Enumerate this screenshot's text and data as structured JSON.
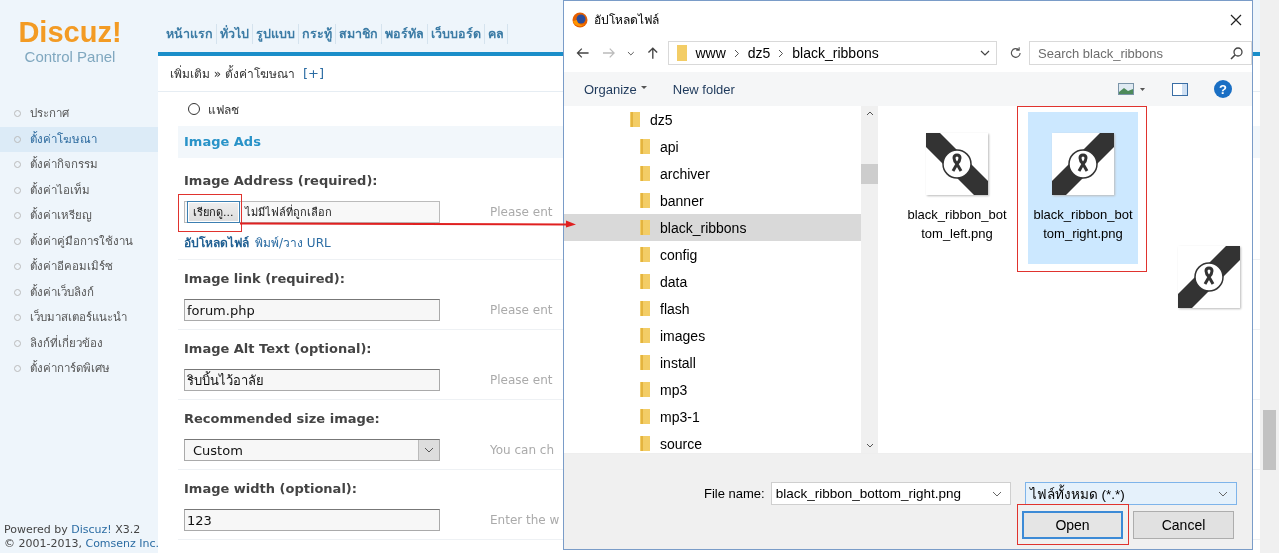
{
  "logo": {
    "name": "Discuz!",
    "subtitle": "Control Panel"
  },
  "nav": [
    "หน้าแรก",
    "ทั่วไป",
    "รูปแบบ",
    "กระทู้",
    "สมาชิก",
    "พอร์ทัล",
    "เว็บบอร์ด",
    "คล"
  ],
  "breadcrumb": {
    "path": "เพิ่มเติม » ตั้งค่าโฆษณา",
    "add": "[+]"
  },
  "sidebar": {
    "items": [
      {
        "label": "ประกาศ",
        "selected": false
      },
      {
        "label": "ตั้งค่าโฆษณา",
        "selected": true
      },
      {
        "label": "ตั้งค่ากิจกรรม",
        "selected": false
      },
      {
        "label": "ตั้งค่าไอเท็ม",
        "selected": false
      },
      {
        "label": "ตั้งค่าเหรียญ",
        "selected": false
      },
      {
        "label": "ตั้งค่าคู่มือการใช้งาน",
        "selected": false
      },
      {
        "label": "ตั้งค่าอีคอมเมิร์ซ",
        "selected": false
      },
      {
        "label": "ตั้งค่าเว็บลิงก์",
        "selected": false
      },
      {
        "label": "เว็บมาสเตอร์แนะนำ",
        "selected": false
      },
      {
        "label": "ลิงก์ที่เกี่ยวข้อง",
        "selected": false
      },
      {
        "label": "ตั้งค่าการ์ดพิเศษ",
        "selected": false
      }
    ]
  },
  "form": {
    "radio": {
      "label": "แฟลช",
      "checked": false
    },
    "section": "Image Ads",
    "fields": [
      {
        "kind": "file",
        "label": "Image Address (required):",
        "button": "เรียกดู...",
        "value": "ไม่มีไฟล์ที่ถูกเลือก",
        "hint": "Please ent",
        "links": [
          {
            "label": "อัปโหลดไฟล์",
            "selected": true
          },
          {
            "label": "พิมพ์/วาง URL",
            "selected": false
          }
        ]
      },
      {
        "kind": "text",
        "label": "Image link (required):",
        "value": "forum.php",
        "hint": "Please ent"
      },
      {
        "kind": "text",
        "label": "Image Alt Text (optional):",
        "value": "ริบบิ้นไว้อาลัย",
        "hint": "Please ent"
      },
      {
        "kind": "select",
        "label": "Recommended size image:",
        "value": "Custom",
        "hint": "You can ch"
      },
      {
        "kind": "text",
        "label": "Image width (optional):",
        "value": "123",
        "hint": "Enter the w"
      }
    ]
  },
  "footer": {
    "powered": "Powered by",
    "product": "Discuz!",
    "version": "X3.2",
    "copyright": "© 2001-2013,",
    "company": "Comsenz Inc."
  },
  "dialog": {
    "title": "อัปโหลดไฟล์",
    "path": [
      "www",
      "dz5",
      "black_ribbons"
    ],
    "search_placeholder": "Search black_ribbons",
    "toolbar": [
      "Organize",
      "New folder"
    ],
    "help": "?",
    "tree": [
      {
        "label": "dz5",
        "selected": false,
        "children": [
          {
            "label": "api",
            "selected": false
          },
          {
            "label": "archiver",
            "selected": false
          },
          {
            "label": "banner",
            "selected": false
          },
          {
            "label": "black_ribbons",
            "selected": true
          },
          {
            "label": "config",
            "selected": false
          },
          {
            "label": "data",
            "selected": false
          },
          {
            "label": "flash",
            "selected": false
          },
          {
            "label": "images",
            "selected": false
          },
          {
            "label": "install",
            "selected": false
          },
          {
            "label": "mp3",
            "selected": false
          },
          {
            "label": "mp3-1",
            "selected": false
          },
          {
            "label": "source",
            "selected": false
          }
        ]
      }
    ],
    "files": [
      {
        "name": "black_ribbon_bot tom_left.png",
        "selected": false
      },
      {
        "name": "black_ribbon_bot tom_right.png",
        "selected": true
      }
    ],
    "file_name_label": "File name:",
    "file_name": "black_ribbon_bottom_right.png",
    "file_type": "ไฟล์ทั้งหมด (*.*)",
    "buttons": [
      {
        "label": "Open",
        "kind": "primary"
      },
      {
        "label": "Cancel",
        "kind": "normal"
      }
    ]
  }
}
